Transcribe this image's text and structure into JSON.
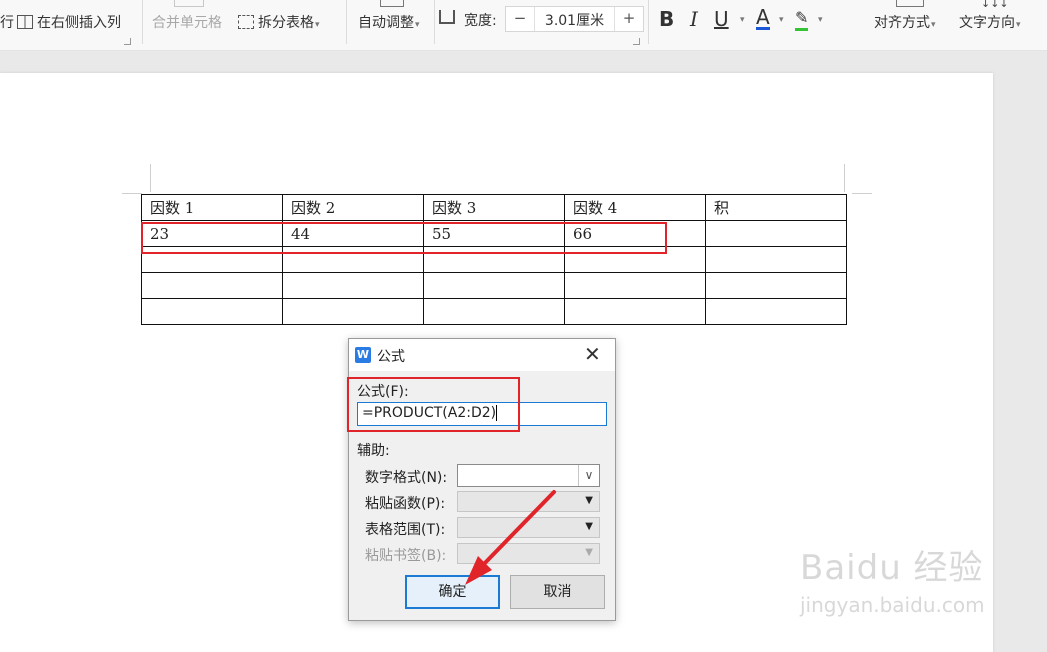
{
  "ribbon": {
    "insert_row_fragment": "行",
    "insert_col_right": "在右侧插入列",
    "merge_cells": "合并单元格",
    "split_table": "拆分表格",
    "auto_adjust": "自动调整",
    "width_label": "宽度:",
    "width_value": "3.01厘米",
    "width_minus": "−",
    "width_plus": "+",
    "bold": "B",
    "italic": "I",
    "underline": "U",
    "font_color": "A",
    "align": "对齐方式",
    "text_direction": "文字方向"
  },
  "table": {
    "rows": [
      [
        "因数 1",
        "因数 2",
        "因数 3",
        "因数 4",
        "积"
      ],
      [
        "23",
        "44",
        "55",
        "66",
        ""
      ],
      [
        "",
        "",
        "",
        "",
        ""
      ],
      [
        "",
        "",
        "",
        "",
        ""
      ],
      [
        "",
        "",
        "",
        "",
        ""
      ]
    ]
  },
  "dialog": {
    "app_icon": "W",
    "title": "公式",
    "formula_label": "公式(F):",
    "formula_value": "=PRODUCT(A2:D2)",
    "assist_label": "辅助:",
    "number_format_label": "数字格式(N):",
    "number_format_value": "",
    "paste_function_label": "粘贴函数(P):",
    "table_range_label": "表格范围(T):",
    "paste_bookmark_label": "粘贴书签(B):",
    "ok": "确定",
    "cancel": "取消"
  },
  "watermark": {
    "brand": "Baidu 经验",
    "url": "jingyan.baidu.com"
  },
  "colors": {
    "highlight_red": "#e0242a",
    "focus_blue": "#1a7ad4",
    "font_color_underline": "#1a56d6",
    "highlighter": "#35c235"
  }
}
